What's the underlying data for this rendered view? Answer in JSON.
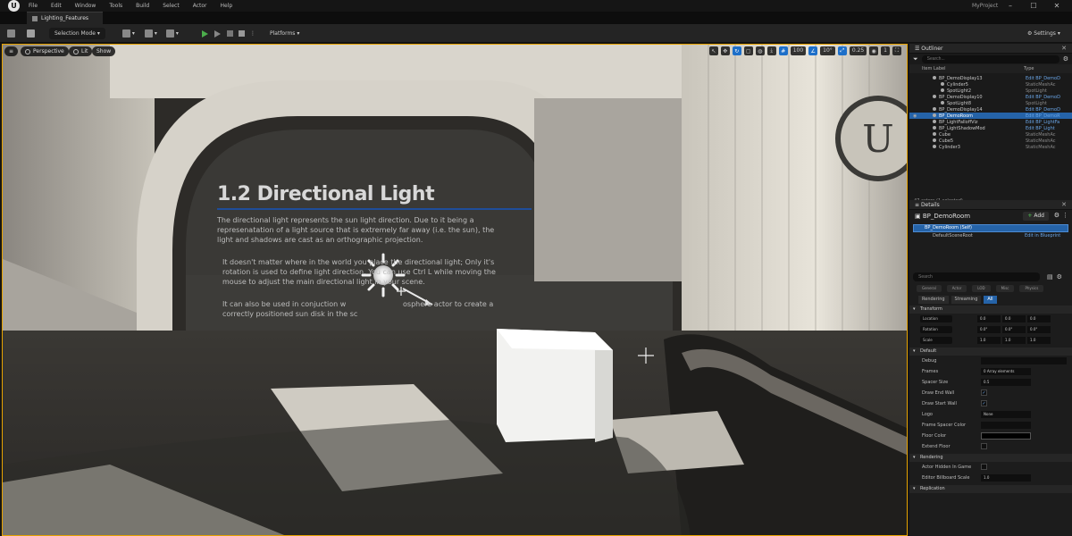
{
  "menu": {
    "logo": "U",
    "items": [
      "File",
      "Edit",
      "Window",
      "Tools",
      "Build",
      "Select",
      "Actor",
      "Help"
    ],
    "project": "MyProject",
    "window_controls": [
      "–",
      "☐",
      "✕"
    ]
  },
  "tab": {
    "label": "Lighting_Features"
  },
  "toolbar": {
    "mode": "Selection Mode",
    "platforms": "Platforms",
    "settings": "Settings"
  },
  "viewport": {
    "perspective": "Perspective",
    "lit": "Lit",
    "show": "Show",
    "grid_value": "100",
    "angle_value": "10°",
    "scale_value": "0.25",
    "camera_speed": "1"
  },
  "slide": {
    "title": "1.2 Directional Light",
    "p1": "The directional light represents the sun light direction. Due to it being a represenatation of a light source that is extremely far away (i.e. the sun), the light and shadows are cast as an orthographic projection.",
    "p2": "It doesn't matter where in the world you place the directional light; Only it's rotation is used to define light direction. You can use Ctrl L while moving the mouse to adjust the main directional light in your scene.",
    "p3": "It can also be used in conjuction w",
    "p3b": "osphere actor to create a",
    "p3c": "correctly positioned sun disk in the sc"
  },
  "outliner": {
    "title": "Outliner",
    "search_placeholder": "Search...",
    "col_label": "Item Label",
    "col_type": "Type",
    "rows": [
      {
        "name": "BP_DemoDisplay13",
        "type": "Edit BP_DemoD",
        "indent": 2,
        "link": true,
        "sel": false
      },
      {
        "name": "Cylinder5",
        "type": "StaticMeshAc",
        "indent": 3,
        "link": false,
        "sel": false
      },
      {
        "name": "SpotLight2",
        "type": "SpotLight",
        "indent": 3,
        "link": false,
        "sel": false
      },
      {
        "name": "BP_DemoDisplay10",
        "type": "Edit BP_DemoD",
        "indent": 2,
        "link": true,
        "sel": false
      },
      {
        "name": "SpotLight8",
        "type": "SpotLight",
        "indent": 3,
        "link": false,
        "sel": false
      },
      {
        "name": "BP_DemoDisplay14",
        "type": "Edit BP_DemoD",
        "indent": 2,
        "link": true,
        "sel": false
      },
      {
        "name": "BP_DemoRoom",
        "type": "Edit BP_DemoR",
        "indent": 2,
        "link": true,
        "sel": true
      },
      {
        "name": "BP_LightFalloffViz",
        "type": "Edit BP_LightFa",
        "indent": 2,
        "link": true,
        "sel": false
      },
      {
        "name": "BP_LightShadowMod",
        "type": "Edit BP_Light",
        "indent": 2,
        "link": true,
        "sel": false
      },
      {
        "name": "Cube",
        "type": "StaticMeshAc",
        "indent": 2,
        "link": false,
        "sel": false
      },
      {
        "name": "Cube5",
        "type": "StaticMeshAc",
        "indent": 2,
        "link": false,
        "sel": false
      },
      {
        "name": "Cylinder3",
        "type": "StaticMeshAc",
        "indent": 2,
        "link": false,
        "sel": false
      }
    ],
    "count": "47 actors (1 selected)"
  },
  "details": {
    "title": "Details",
    "actor": "BP_DemoRoom",
    "add": "Add",
    "root_component": "BP_DemoRoom (Self)",
    "child_component": "DefaultSceneRoot",
    "child_link": "Edit in Blueprint",
    "search_placeholder": "Search",
    "chips": [
      "General",
      "Actor",
      "LOD",
      "Misc",
      "Physics"
    ],
    "tabs": [
      "Rendering",
      "Streaming",
      "All"
    ],
    "transform": {
      "label": "Transform",
      "rows": [
        {
          "label": "Location",
          "x": "0.0",
          "y": "0.0",
          "z": "0.0"
        },
        {
          "label": "Rotation",
          "x": "0.0°",
          "y": "0.0°",
          "z": "0.0°"
        },
        {
          "label": "Scale",
          "x": "1.0",
          "y": "1.0",
          "z": "1.0"
        }
      ]
    },
    "default_section": "Default",
    "props": [
      {
        "label": "Debug",
        "value": ""
      },
      {
        "label": "Frames",
        "value": "0 Array elements"
      },
      {
        "label": "Spacer Size",
        "value": "0.5"
      },
      {
        "label": "Draw End Wall",
        "value": "✓"
      },
      {
        "label": "Draw Start Wall",
        "value": "✓"
      },
      {
        "label": "Logo",
        "value": "None"
      },
      {
        "label": "Frame Spacer Color",
        "value": ""
      },
      {
        "label": "Floor Color",
        "value": ""
      },
      {
        "label": "Extend Floor",
        "value": ""
      }
    ],
    "rendering_section": "Rendering",
    "rendering_props": [
      {
        "label": "Actor Hidden In Game",
        "value": ""
      },
      {
        "label": "Editor Billboard Scale",
        "value": "1.0"
      }
    ],
    "replication_section": "Replication"
  }
}
